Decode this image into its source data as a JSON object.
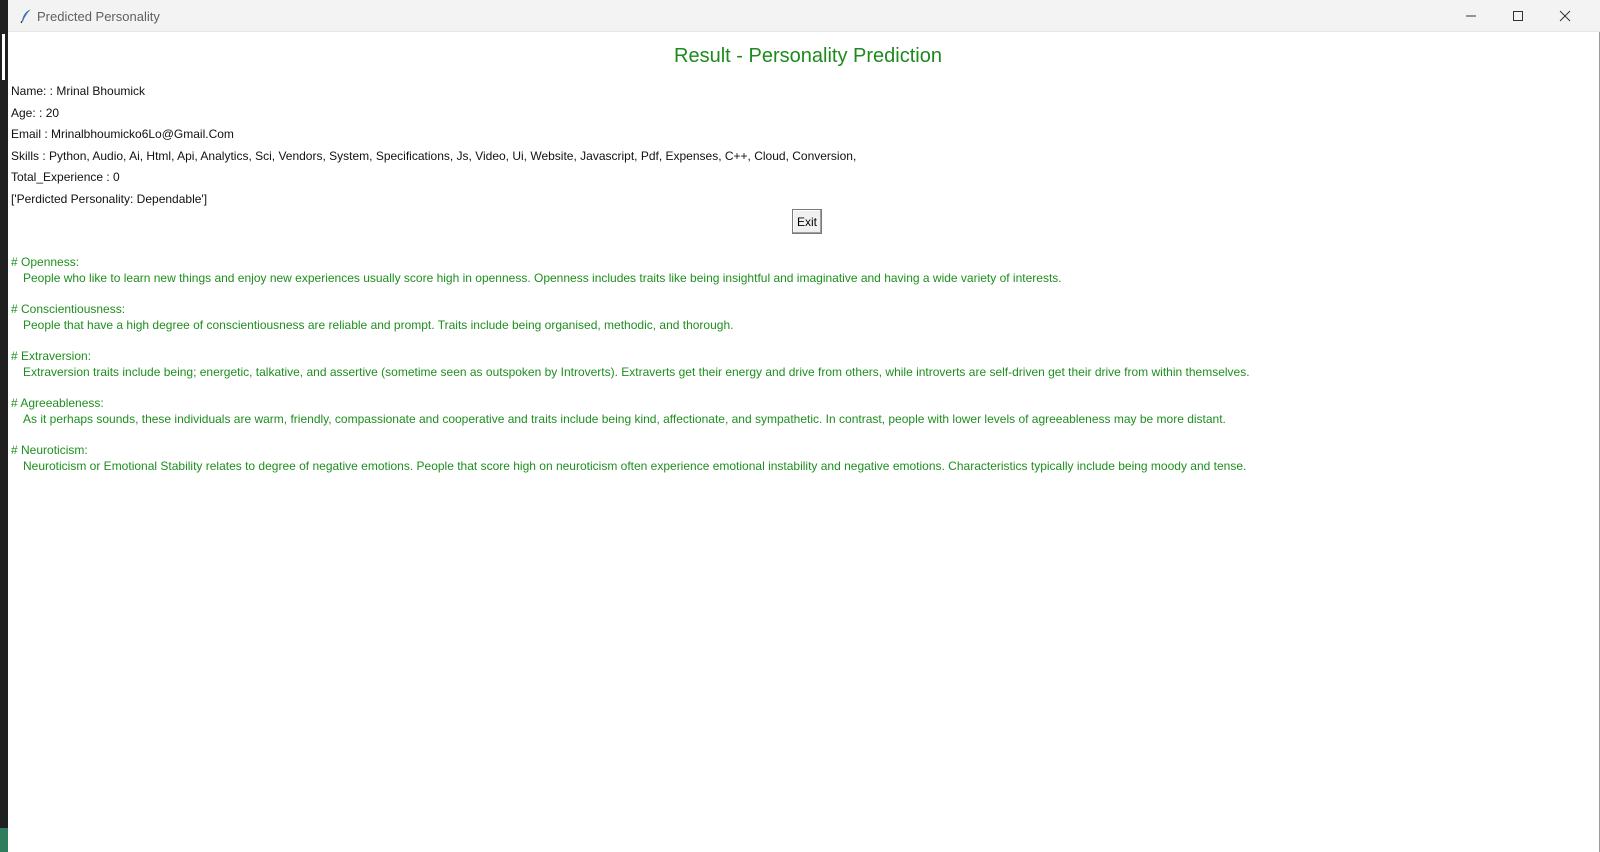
{
  "window": {
    "title": "Predicted Personality",
    "controls": {
      "minimize": "minimize-icon",
      "maximize": "maximize-icon",
      "close": "close-icon"
    }
  },
  "heading": "Result - Personality Prediction",
  "info": {
    "name": "Name: : Mrinal Bhoumick",
    "age": "Age: : 20",
    "email": "Email : Mrinalbhoumicko6Lo@Gmail.Com",
    "skills": "Skills : Python, Audio, Ai, Html, Api, Analytics, Sci, Vendors, System, Specifications, Js, Video, Ui, Website, Javascript, Pdf, Expenses, C++, Cloud, Conversion,",
    "experience": "Total_Experience : 0",
    "prediction": "['Perdicted Personality: Dependable']"
  },
  "exit_label": "Exit",
  "traits": [
    {
      "title": "# Openness:",
      "desc": "People who like to learn new things and enjoy new experiences usually score high in openness. Openness includes traits like being insightful and imaginative and having a wide variety of interests."
    },
    {
      "title": "# Conscientiousness:",
      "desc": "People that have a high degree of conscientiousness are reliable and prompt. Traits include being organised, methodic, and thorough."
    },
    {
      "title": "# Extraversion:",
      "desc": "Extraversion traits include being; energetic, talkative, and assertive (sometime seen as outspoken by Introverts). Extraverts get their energy and drive from others, while introverts are self-driven get their drive from within themselves."
    },
    {
      "title": "# Agreeableness:",
      "desc": "As it perhaps sounds, these individuals are warm, friendly, compassionate and cooperative and traits include being kind, affectionate, and sympathetic. In contrast, people with lower levels of agreeableness may be more distant."
    },
    {
      "title": "# Neuroticism:",
      "desc": "Neuroticism or Emotional Stability relates to degree of negative emotions. People that score high on neuroticism often experience emotional instability and negative emotions. Characteristics typically include being moody and tense."
    }
  ],
  "colors": {
    "heading": "#1d8a1d",
    "trait_text": "#1e8f1e",
    "info_text": "#111111"
  }
}
